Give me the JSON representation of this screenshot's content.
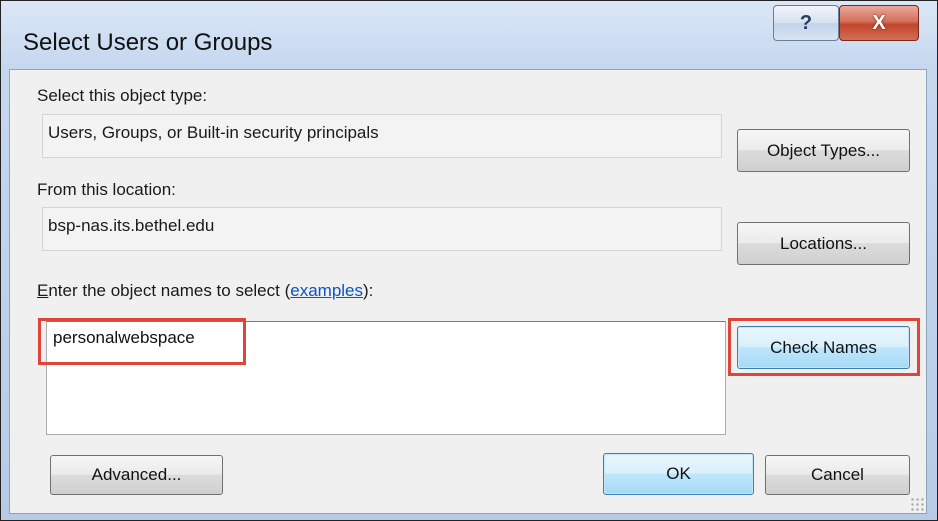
{
  "window": {
    "title": "Select Users or Groups",
    "help_label": "?",
    "close_label": "X"
  },
  "object_type": {
    "label": "Select this object type:",
    "value": "Users, Groups, or Built-in security principals",
    "button_label": "Object Types..."
  },
  "location": {
    "label": "From this location:",
    "value": "bsp-nas.its.bethel.edu",
    "button_label": "Locations..."
  },
  "names": {
    "label_prefix_underlined": "E",
    "label_prefix": "nter the object names to select (",
    "label_link": "examples",
    "label_suffix": "):",
    "value": "personalwebspace",
    "check_button_label": "Check Names"
  },
  "footer": {
    "advanced_label": "Advanced...",
    "ok_label": "OK",
    "cancel_label": "Cancel"
  },
  "colors": {
    "highlight": "#e0453a",
    "link": "#0a54c4"
  }
}
